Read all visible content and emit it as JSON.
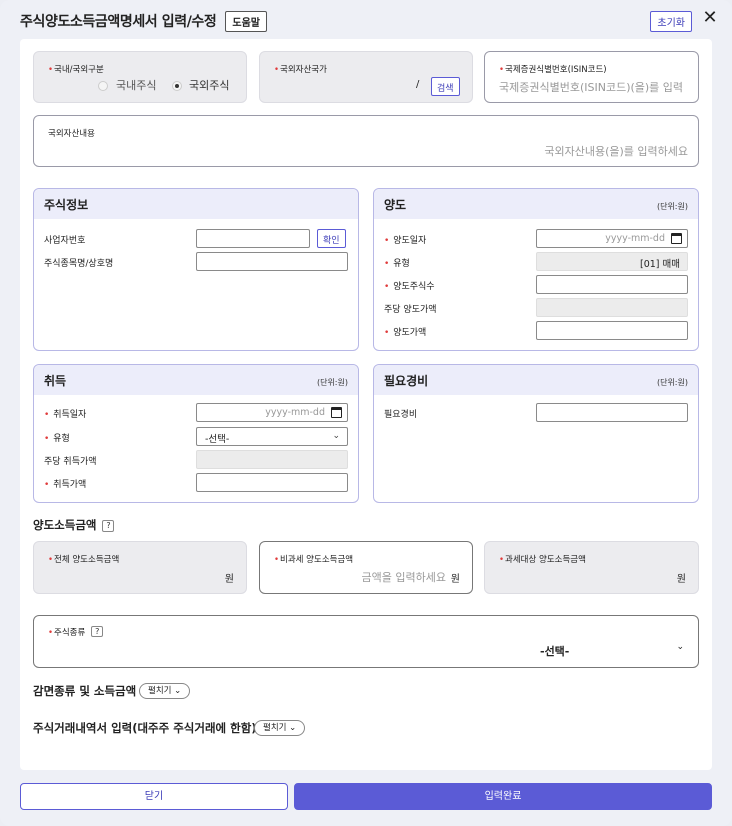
{
  "header": {
    "title": "주식양도소득금액명세서 입력/수정",
    "help_label": "도움말",
    "reset_label": "초기화",
    "close_glyph": "✕"
  },
  "top_fields": {
    "domestic_foreign": {
      "label": "국내/국외구분",
      "options": [
        "국내주식",
        "국외주식"
      ],
      "selected": "국외주식"
    },
    "asset_country": {
      "label": "국외자산국가",
      "value": "/",
      "search_label": "검색"
    },
    "isin": {
      "label": "국제증권식별번호(ISIN코드)",
      "placeholder": "국제증권식별번호(ISIN코드)(을)를 입력"
    },
    "asset_desc": {
      "label": "국외자산내용",
      "placeholder": "국외자산내용(을)를 입력하세요"
    }
  },
  "stock_info": {
    "title": "주식정보",
    "business_no_label": "사업자번호",
    "confirm_label": "확인",
    "stock_name_label": "주식종목명/상호명"
  },
  "transfer": {
    "title": "양도",
    "unit": "(단위:원)",
    "date_label": "양도일자",
    "date_placeholder": "yyyy-mm-dd",
    "type_label": "유형",
    "type_value": "[01] 매매",
    "shares_label": "양도주식수",
    "per_share_label": "주당 양도가액",
    "amount_label": "양도가액"
  },
  "acquisition": {
    "title": "취득",
    "unit": "(단위:원)",
    "date_label": "취득일자",
    "date_placeholder": "yyyy-mm-dd",
    "type_label": "유형",
    "type_value": "-선택-",
    "per_share_label": "주당 취득가액",
    "amount_label": "취득가액"
  },
  "expenses": {
    "title": "필요경비",
    "unit": "(단위:원)",
    "field_label": "필요경비"
  },
  "income": {
    "title": "양도소득금액",
    "help_glyph": "?",
    "total_label": "전체 양도소득금액",
    "total_unit": "원",
    "nontax_label": "비과세 양도소득금액",
    "nontax_placeholder": "금액을 입력하세요",
    "nontax_unit": "원",
    "taxable_label": "과세대상 양도소득금액",
    "taxable_unit": "원"
  },
  "stock_type": {
    "label": "주식종류",
    "help_glyph": "?",
    "value": "-선택-"
  },
  "reduction": {
    "title": "감면종류 및 소득금액",
    "expand_label": "펼치기 ⌄"
  },
  "trade_history": {
    "title": "주식거래내역서 입력(대주주 주식거래에 한함)",
    "expand_label": "펼치기 ⌄"
  },
  "footer": {
    "close_label": "닫기",
    "submit_label": "입력완료"
  }
}
